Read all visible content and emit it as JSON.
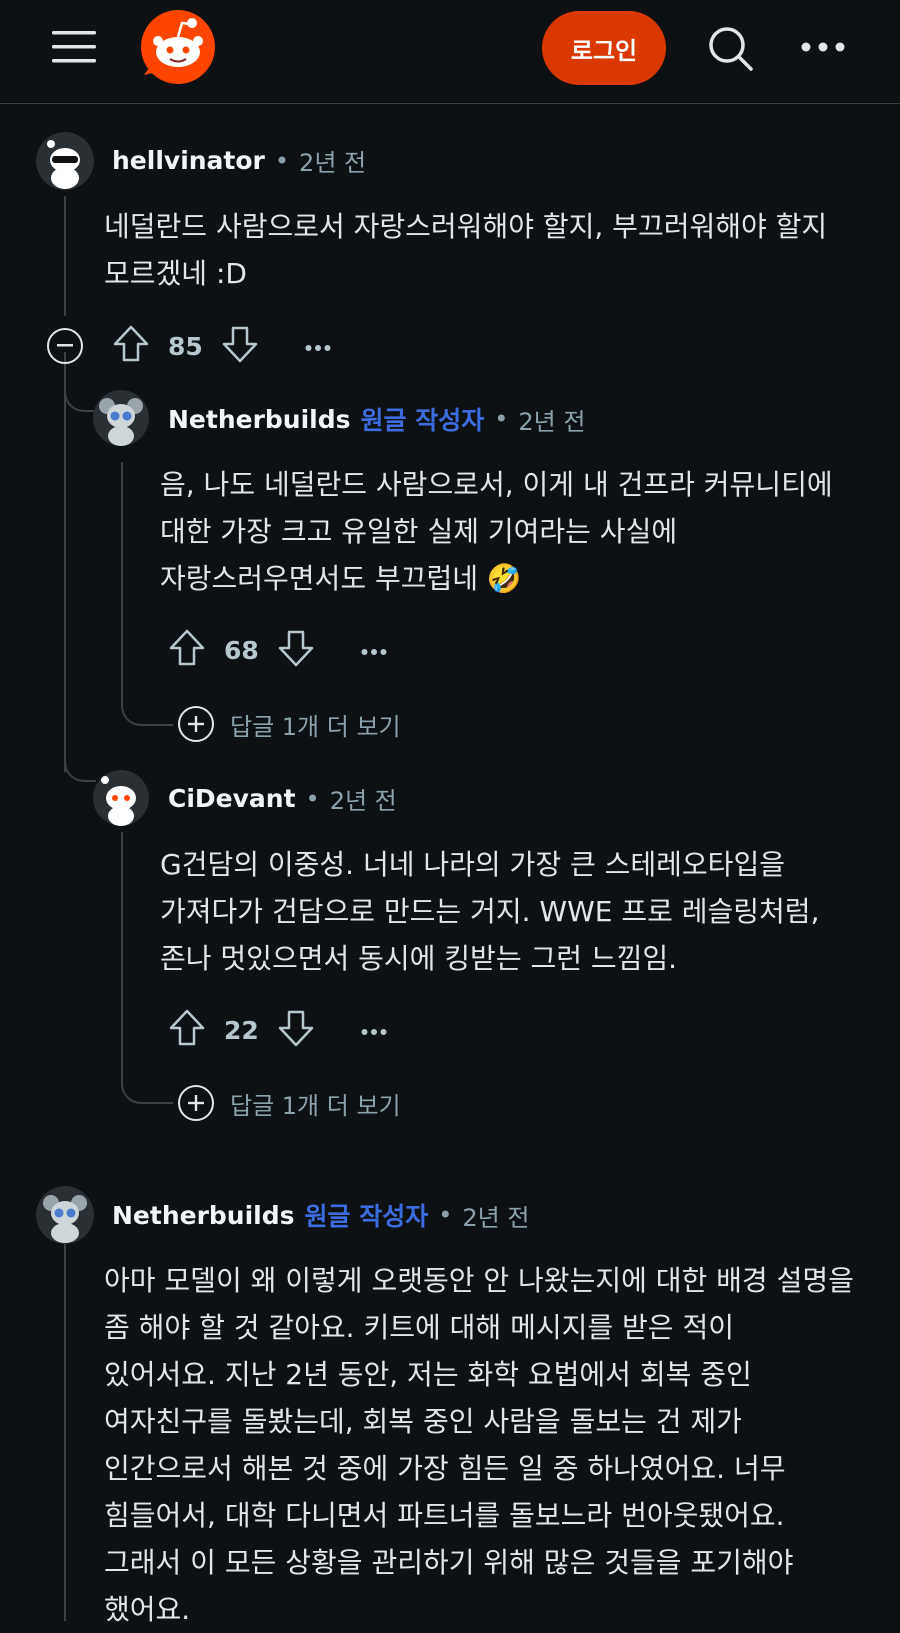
{
  "header": {
    "login_label": "로그인",
    "menu_icon": "hamburger-icon",
    "logo_icon": "reddit-snoo-icon",
    "search_icon": "search-icon",
    "more_icon": "more-icon",
    "accent_color": "#d93900"
  },
  "comments": [
    {
      "author": "hellvinator",
      "op_label": "",
      "time": "2년 전",
      "body": "네덜란드 사람으로서 자랑스러워해야 할지, 부끄러워해야 할지 모르겠네 :D",
      "votes": "85"
    },
    {
      "author": "Netherbuilds",
      "op_label": "원글 작성자",
      "time": "2년 전",
      "body": "음, 나도 네덜란드 사람으로서, 이게 내 건프라 커뮤니티에 대한 가장 크고 유일한 실제 기여라는 사실에 자랑스러우면서도 부끄럽네 🤣",
      "votes": "68",
      "more_replies": "답글 1개 더 보기"
    },
    {
      "author": "CiDevant",
      "op_label": "",
      "time": "2년 전",
      "body": "G건담의 이중성. 너네 나라의 가장 큰 스테레오타입을 가져다가 건담으로 만드는 거지. WWE 프로 레슬링처럼, 존나 멋있으면서 동시에 킹받는 그런 느낌임.",
      "votes": "22",
      "more_replies": "답글 1개 더 보기"
    },
    {
      "author": "Netherbuilds",
      "op_label": "원글 작성자",
      "time": "2년 전",
      "body": "아마 모델이 왜 이렇게 오랫동안 안 나왔는지에 대한 배경 설명을 좀 해야 할 것 같아요. 키트에 대해 메시지를 받은 적이 있어서요. 지난 2년 동안, 저는 화학 요법에서 회복 중인 여자친구를 돌봤는데, 회복 중인 사람을 돌보는 건 제가 인간으로서 해본 것 중에 가장 힘든 일 중 하나였어요. 너무 힘들어서, 대학 다니면서 파트너를 돌보느라 번아웃됐어요. 그래서 이 모든 상황을 관리하기 위해 많은 것들을 포기해야 했어요."
    }
  ],
  "separator": "•"
}
